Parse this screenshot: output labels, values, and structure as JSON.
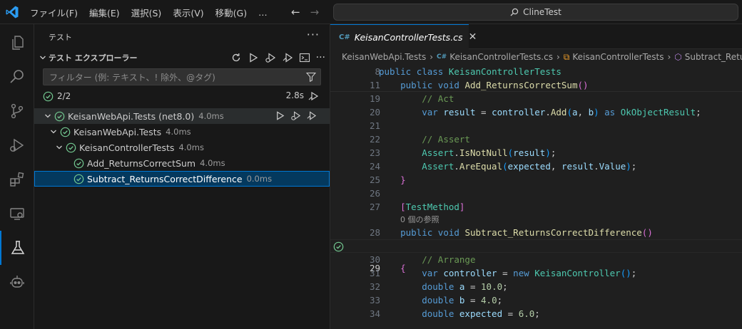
{
  "menu": [
    "ファイル(F)",
    "編集(E)",
    "選択(S)",
    "表示(V)",
    "移動(G)",
    "…"
  ],
  "command_center": "ClineTest",
  "sidebar": {
    "title": "テスト",
    "section_title": "テスト エクスプローラー",
    "filter_placeholder": "フィルター (例: テキスト、! 除外、@タグ)",
    "summary_count": "2/2",
    "summary_duration": "2.8s",
    "tree": [
      {
        "label": "KeisanWebApi.Tests (net8.0)",
        "duration": "4.0ms"
      },
      {
        "label": "KeisanWebApi.Tests",
        "duration": "4.0ms"
      },
      {
        "label": "KeisanControllerTests",
        "duration": "4.0ms"
      },
      {
        "label": "Add_ReturnsCorrectSum",
        "duration": "4.0ms"
      },
      {
        "label": "Subtract_ReturnsCorrectDifference",
        "duration": "0.0ms"
      }
    ]
  },
  "editor": {
    "tab_label": "KeisanControllerTests.cs",
    "breadcrumb": [
      "KeisanWebApi.Tests",
      "KeisanControllerTests.cs",
      "KeisanControllerTests",
      "Subtract_Retur"
    ],
    "codelens": "0 個の参照",
    "line_numbers": [
      "8",
      "11",
      "19",
      "20",
      "21",
      "22",
      "23",
      "24",
      "25",
      "26",
      "27",
      "28",
      "29",
      "30",
      "31",
      "32",
      "33",
      "34"
    ]
  },
  "colors": {
    "accent": "#0078d4",
    "pass": "#73c991"
  }
}
